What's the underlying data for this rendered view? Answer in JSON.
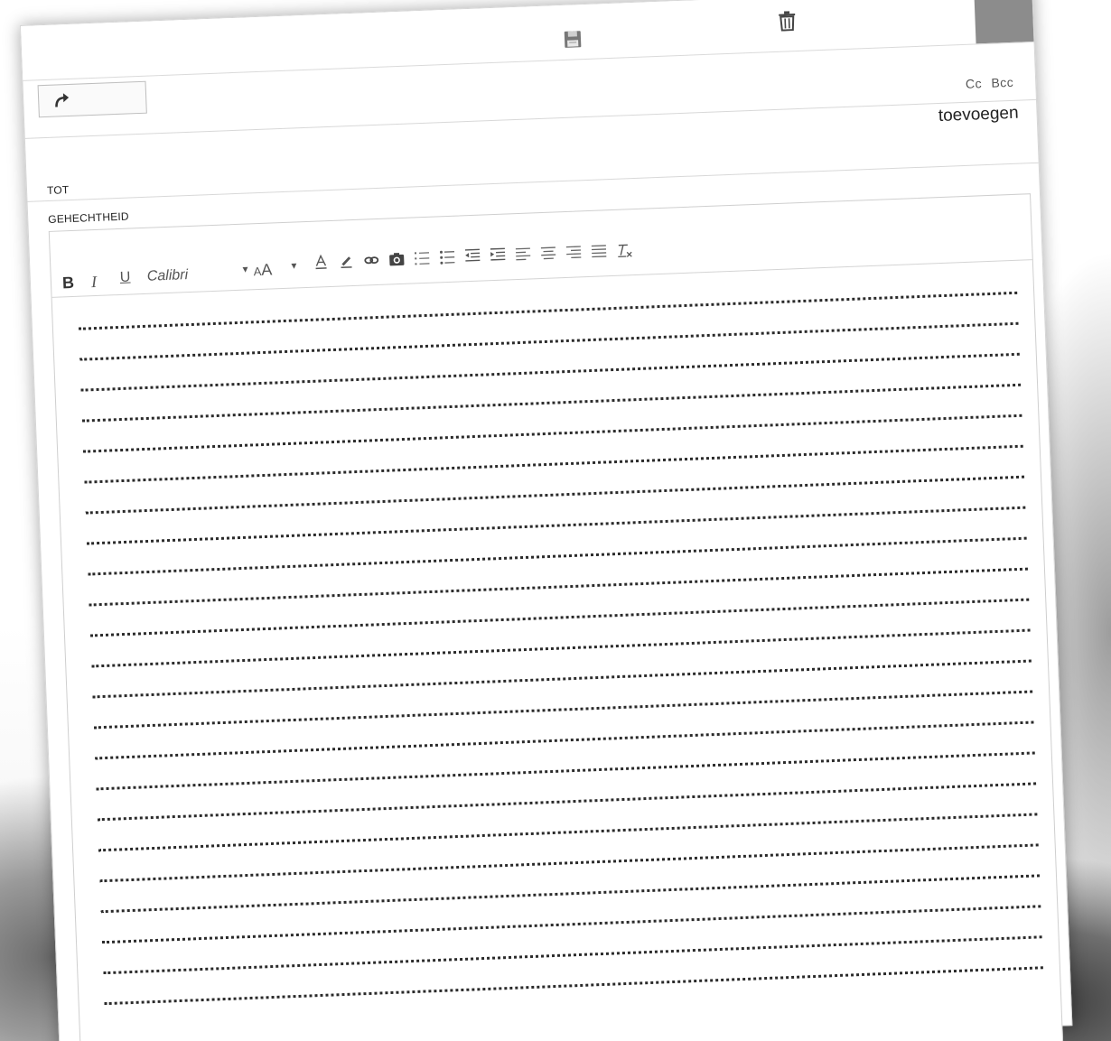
{
  "header": {
    "save_icon": "save-icon",
    "delete_icon": "trash-icon",
    "accent_color": "#8c8c8c"
  },
  "actions": {
    "forward_icon": "forward-arrow-icon"
  },
  "recipients": {
    "cc_label": "Cc",
    "bcc_label": "Bcc",
    "add_label": "toevoegen",
    "to_label": "TOT",
    "attachment_label": "GEHECHTHEID"
  },
  "toolbar": {
    "bold": "B",
    "italic": "I",
    "underline": "U",
    "font_name": "Calibri",
    "font_size_label_small": "A",
    "font_size_label_large": "A",
    "icons": [
      "font-color-icon",
      "highlight-icon",
      "link-icon",
      "camera-icon",
      "numbered-list-icon",
      "bulleted-list-icon",
      "decrease-indent-icon",
      "increase-indent-icon",
      "align-left-icon",
      "align-center-icon",
      "align-right-icon",
      "justify-icon",
      "clear-formatting-icon"
    ]
  },
  "body": {
    "ruled_lines": 23
  }
}
